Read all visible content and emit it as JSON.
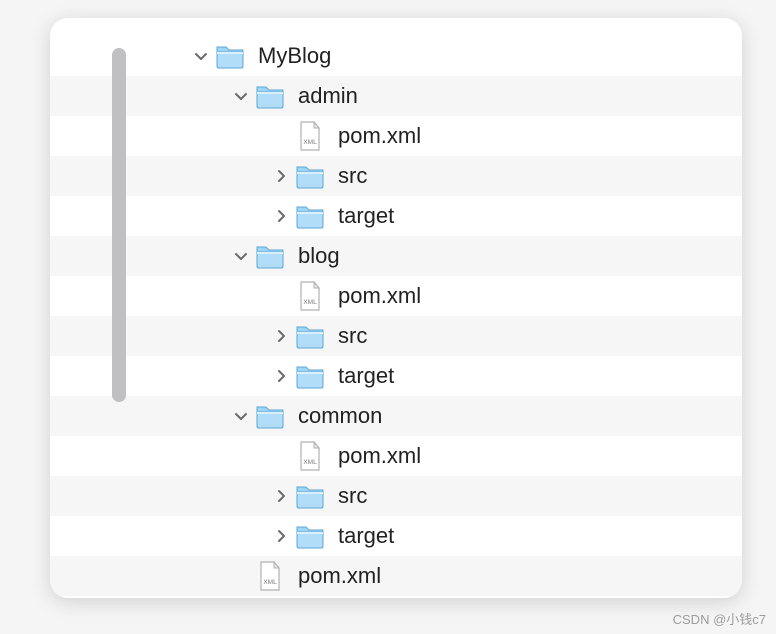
{
  "tree": {
    "rows": [
      {
        "level": 0,
        "expand": "down",
        "icon": "folder",
        "label": "MyBlog"
      },
      {
        "level": 1,
        "expand": "down",
        "icon": "folder",
        "label": "admin"
      },
      {
        "level": 2,
        "expand": "none",
        "icon": "xml",
        "label": "pom.xml"
      },
      {
        "level": 2,
        "expand": "right",
        "icon": "folder",
        "label": "src"
      },
      {
        "level": 2,
        "expand": "right",
        "icon": "folder",
        "label": "target"
      },
      {
        "level": 1,
        "expand": "down",
        "icon": "folder",
        "label": "blog"
      },
      {
        "level": 2,
        "expand": "none",
        "icon": "xml",
        "label": "pom.xml"
      },
      {
        "level": 2,
        "expand": "right",
        "icon": "folder",
        "label": "src"
      },
      {
        "level": 2,
        "expand": "right",
        "icon": "folder",
        "label": "target"
      },
      {
        "level": 1,
        "expand": "down",
        "icon": "folder",
        "label": "common"
      },
      {
        "level": 2,
        "expand": "none",
        "icon": "xml",
        "label": "pom.xml"
      },
      {
        "level": 2,
        "expand": "right",
        "icon": "folder",
        "label": "src"
      },
      {
        "level": 2,
        "expand": "right",
        "icon": "folder",
        "label": "target"
      },
      {
        "level": 1,
        "expand": "none",
        "icon": "xml",
        "label": "pom.xml"
      }
    ]
  },
  "watermark": "CSDN @小钱c7"
}
